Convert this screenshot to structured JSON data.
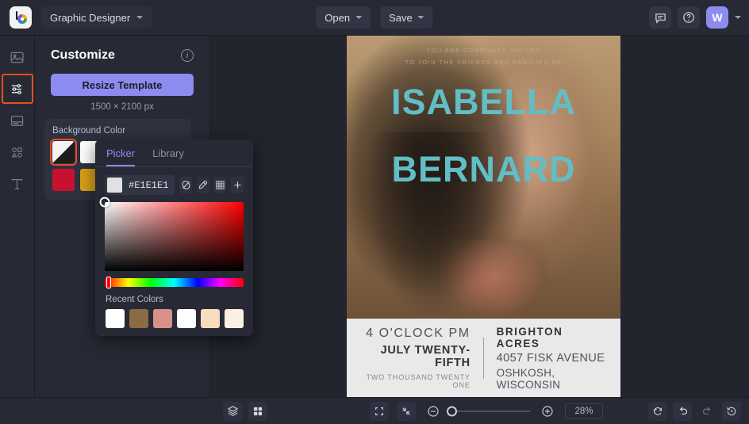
{
  "topbar": {
    "logo_icon": "befunky-logo-icon",
    "app_switcher_label": "Graphic Designer",
    "open_label": "Open",
    "save_label": "Save",
    "chat_icon": "chat-bubble-icon",
    "help_icon": "question-circle-icon",
    "avatar_initial": "W"
  },
  "rail": {
    "items": [
      {
        "name": "image-manager",
        "icon": "image-icon"
      },
      {
        "name": "customize",
        "icon": "sliders-icon",
        "active": true
      },
      {
        "name": "templates",
        "icon": "template-icon"
      },
      {
        "name": "graphics",
        "icon": "shapes-icon"
      },
      {
        "name": "text",
        "icon": "text-icon"
      }
    ]
  },
  "panel": {
    "title": "Customize",
    "info_icon": "info-icon",
    "resize_button": "Resize Template",
    "canvas_dimensions": "1500 × 2100 px",
    "background_color_label": "Background Color",
    "swatches": [
      {
        "name": "transparent-diagonal",
        "color": "diagonal",
        "selected": true
      },
      {
        "name": "white",
        "color": "#ffffff"
      },
      {
        "name": "crimson",
        "color": "#c9102f"
      },
      {
        "name": "gold",
        "color": "#d9a017"
      }
    ]
  },
  "picker": {
    "tabs": [
      {
        "label": "Picker",
        "active": true
      },
      {
        "label": "Library",
        "active": false
      }
    ],
    "hex_value": "#E1E1E1",
    "hex_swatch_color": "#e1e1e1",
    "tools": [
      {
        "name": "no-color-icon",
        "glyph": "transparent"
      },
      {
        "name": "eyedropper-icon",
        "glyph": "eyedropper"
      },
      {
        "name": "palette-grid-icon",
        "glyph": "grid"
      },
      {
        "name": "add-color-icon",
        "glyph": "plus"
      }
    ],
    "hue": "#ff0000",
    "recent_colors_label": "Recent Colors",
    "recent_colors": [
      "#ffffff",
      "#8b6b43",
      "#d69189",
      "#fdfdfd",
      "#f7ddbe",
      "#fbf0e3"
    ]
  },
  "canvas": {
    "invite_line1": "YOU ARE CORDIALLY INVITED",
    "invite_line2": "TO JOIN THE FRIENDS AND FAMILIES OF",
    "name_first": "ISABELLA",
    "name_last": "BERNARD",
    "name_color": "#62bec5",
    "card": {
      "time": "4 O'CLOCK PM",
      "date": "JULY TWENTY-FIFTH",
      "year": "TWO THOUSAND TWENTY ONE",
      "venue": "BRIGHTON ACRES",
      "street": "4057 FISK AVENUE",
      "city": "OSHKOSH, WISCONSIN"
    }
  },
  "bottombar": {
    "layers_icon": "layers-icon",
    "grid_icon": "grid-view-icon",
    "fullscreen_icon": "fit-screen-icon",
    "collapse_icon": "collapse-icon",
    "zoom_out_icon": "zoom-out-icon",
    "zoom_in_icon": "zoom-in-icon",
    "zoom_level": "28%",
    "reset_icon": "reset-icon",
    "undo_icon": "undo-icon",
    "redo_icon": "redo-icon",
    "history_icon": "history-icon"
  }
}
